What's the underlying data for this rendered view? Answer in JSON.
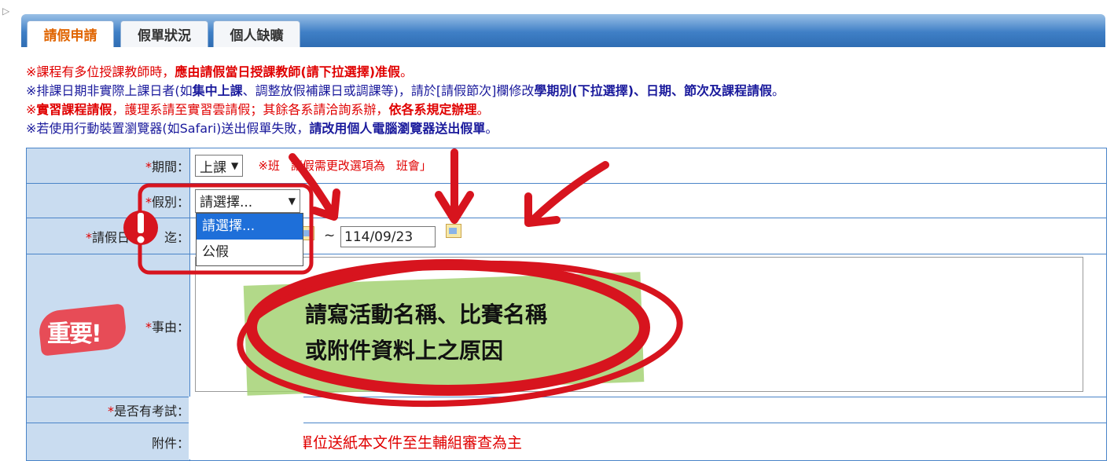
{
  "tabs": [
    {
      "label": "請假申請",
      "active": true
    },
    {
      "label": "假單狀況",
      "active": false
    },
    {
      "label": "個人缺曠",
      "active": false
    }
  ],
  "notes": {
    "n1_a": "※課程有多位授課教師時，",
    "n1_b": "應由請假當日授課教師(請下拉選擇)准假",
    "n1_c": "。",
    "n2_a": "※排課日期非實際上課日者(如",
    "n2_b": "集中上課",
    "n2_c": "、調整放假補課日或調課等)，請於[請假節次]欄修改",
    "n2_d": "學期別(下拉選擇)、日期、節次及課程請假",
    "n2_e": "。",
    "n3_a": "※",
    "n3_b": "實習課程請假",
    "n3_c": "，護理系請至實習雲請假；其餘各系請洽詢系辦，",
    "n3_d": "依各系規定辦理",
    "n3_e": "。",
    "n4_a": "※若使用行動裝置瀏覽器(如Safari)送出假單失敗，",
    "n4_b": "請改用個人電腦瀏覽器送出假單",
    "n4_c": "。"
  },
  "form": {
    "period": {
      "label": "期間：",
      "value": "上課",
      "hint_before": "※班",
      "hint_after": "請假需更改選項為",
      "hint_end": "班會」"
    },
    "leave_type": {
      "label": "假別：",
      "value": "請選擇...",
      "options": [
        "請選擇...",
        "公假"
      ]
    },
    "date": {
      "label_a": "請假日",
      "label_b": "迄：",
      "end": "114/09/23",
      "sep": "~"
    },
    "reason": {
      "label": "事由："
    },
    "exam": {
      "label": "是否有考試："
    },
    "attachment": {
      "label": "附件：",
      "text": "免上傳，以核准單位送紙本文件至生輔組審查為主"
    }
  },
  "annotation": {
    "line1": "請寫活動名稱、比賽名稱",
    "line2": "或附件資料上之原因",
    "badge": "重要!"
  },
  "colors": {
    "red": "#e00000",
    "blue": "#1a1a9c",
    "tab_orange": "#e06400",
    "label_bg": "#c9dcf0",
    "annotation_red": "#d7141e"
  }
}
